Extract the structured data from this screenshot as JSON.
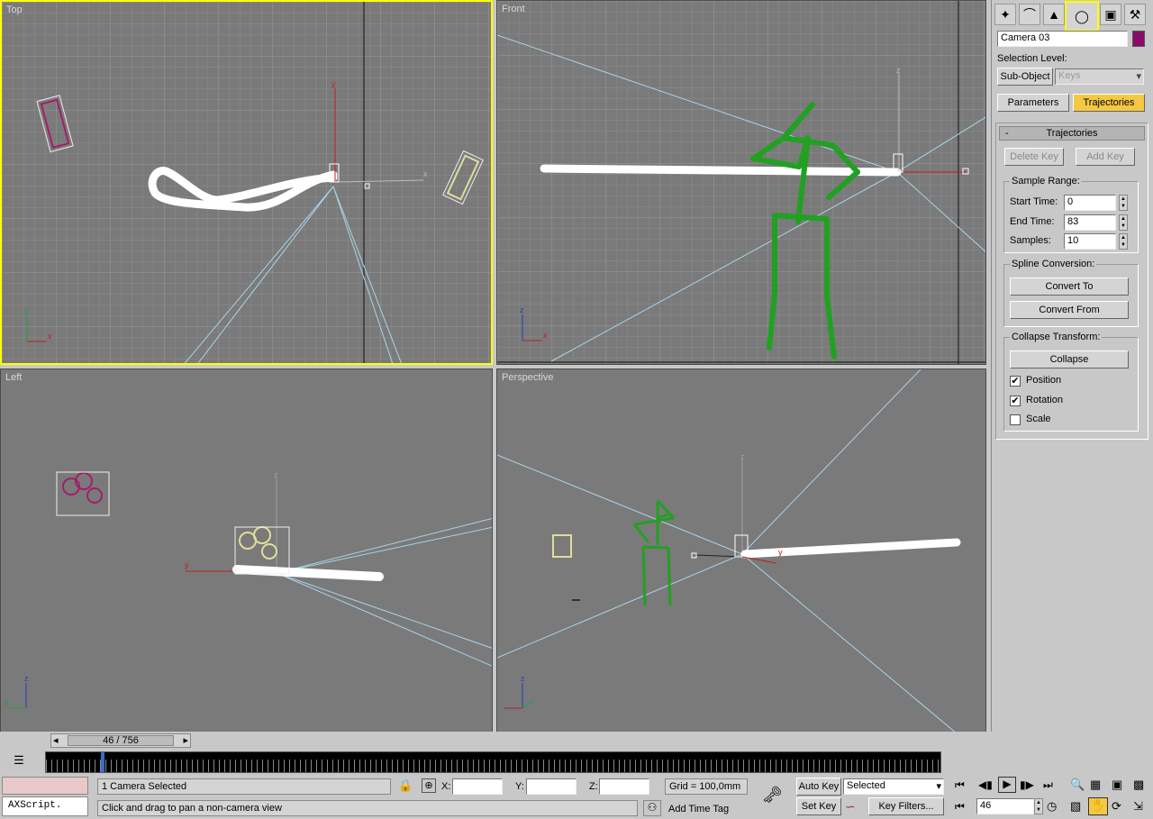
{
  "viewports": {
    "top": "Top",
    "front": "Front",
    "left": "Left",
    "perspective": "Perspective"
  },
  "axes": {
    "x": "x",
    "y": "y",
    "z": "z"
  },
  "panel": {
    "tabs": [
      "create-icon",
      "modify-icon",
      "hierarchy-icon",
      "motion-icon",
      "display-icon",
      "utilities-icon"
    ],
    "object_name": "Camera 03",
    "object_color": "#8a0a6a",
    "selection_level_label": "Selection Level:",
    "sub_object_label": "Sub-Object",
    "sub_object_value": "Keys",
    "parameters_label": "Parameters",
    "trajectories_label": "Trajectories",
    "rollout_toggle": "-",
    "rollout_title": "Trajectories",
    "delete_key": "Delete Key",
    "add_key": "Add Key",
    "sample_range": {
      "title": "Sample Range:",
      "start_label": "Start Time:",
      "start_value": "0",
      "end_label": "End Time:",
      "end_value": "83",
      "samples_label": "Samples:",
      "samples_value": "10"
    },
    "spline": {
      "title": "Spline Conversion:",
      "convert_to": "Convert To",
      "convert_from": "Convert From"
    },
    "collapse": {
      "title": "Collapse Transform:",
      "button": "Collapse",
      "position": "Position",
      "rotation": "Rotation",
      "scale": "Scale",
      "position_checked": true,
      "rotation_checked": true,
      "scale_checked": false
    }
  },
  "timeline": {
    "frame": "46 / 756",
    "current_frame": 46,
    "total_frames": 756
  },
  "status": {
    "selection": "1 Camera Selected",
    "prompt": "Click and drag to pan a non-camera view",
    "maxscript": "AXScript.",
    "x_label": "X:",
    "y_label": "Y:",
    "z_label": "Z:",
    "grid": "Grid = 100,0mm",
    "add_time_tag": "Add Time Tag",
    "auto_key": "Auto Key",
    "set_key": "Set Key",
    "key_mode": "Selected",
    "key_filters": "Key Filters...",
    "frame_field": "46"
  }
}
